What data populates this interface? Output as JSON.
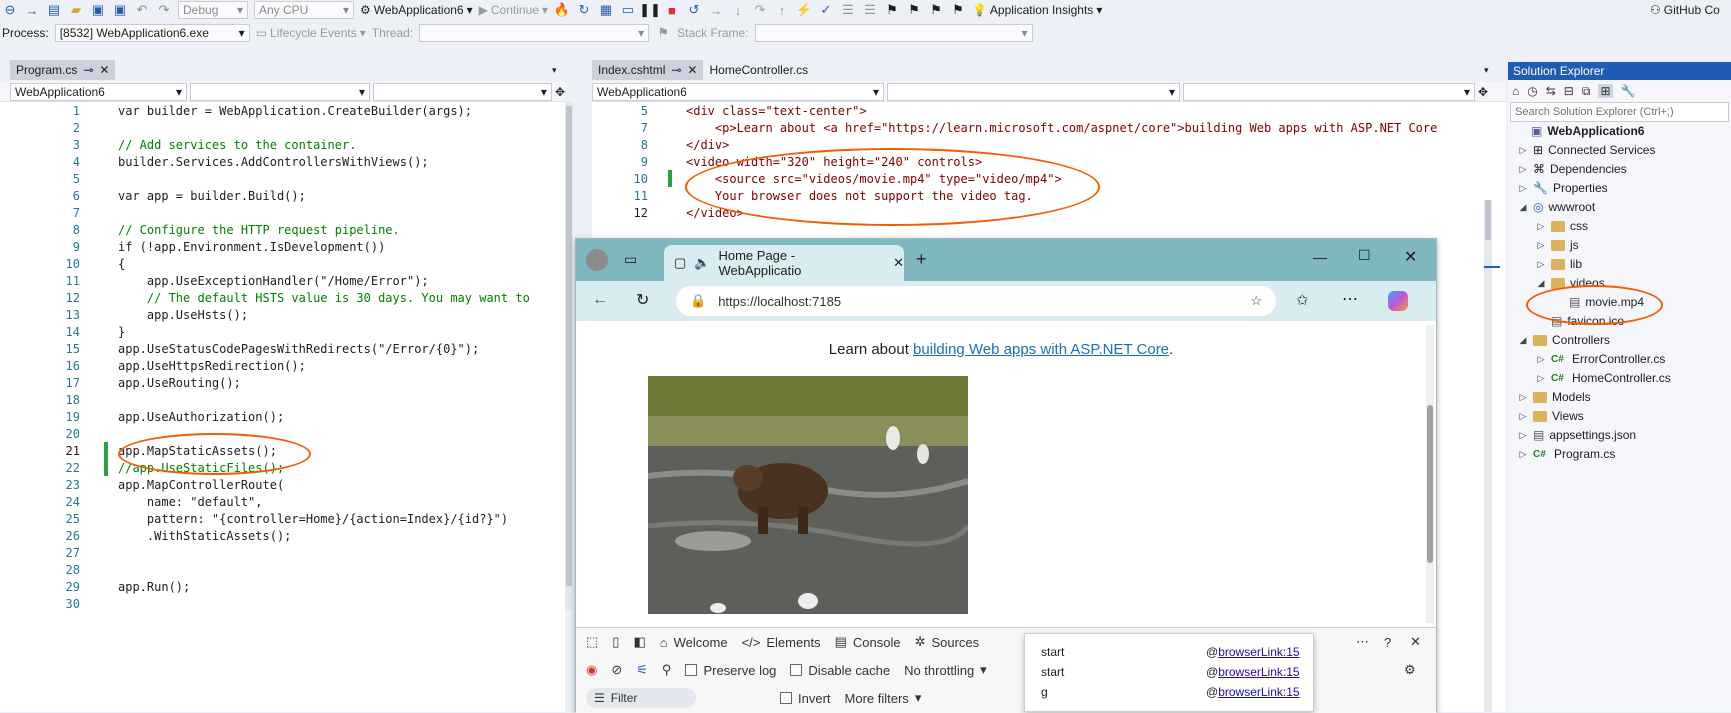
{
  "toolbar": {
    "config": "Debug",
    "platform": "Any CPU",
    "run_target": "WebApplication6",
    "continue_label": "Continue",
    "app_insights": "Application Insights",
    "github_copilot": "GitHub Co"
  },
  "debugbar": {
    "process_label": "Process:",
    "process_value": "[8532] WebApplication6.exe",
    "lifecycle_label": "Lifecycle Events",
    "thread_label": "Thread:",
    "stackframe_label": "Stack Frame:"
  },
  "left_editor": {
    "tab": "Program.cs",
    "nav_project": "WebApplication6",
    "lines": [
      {
        "n": "1",
        "code": "var builder = WebApplication.CreateBuilder(args);"
      },
      {
        "n": "2",
        "code": ""
      },
      {
        "n": "3",
        "code": "// Add services to the container."
      },
      {
        "n": "4",
        "code": "builder.Services.AddControllersWithViews();"
      },
      {
        "n": "5",
        "code": ""
      },
      {
        "n": "6",
        "code": "var app = builder.Build();"
      },
      {
        "n": "7",
        "code": ""
      },
      {
        "n": "8",
        "code": "// Configure the HTTP request pipeline."
      },
      {
        "n": "9",
        "code": "if (!app.Environment.IsDevelopment())"
      },
      {
        "n": "10",
        "code": "{"
      },
      {
        "n": "11",
        "code": "    app.UseExceptionHandler(\"/Home/Error\");"
      },
      {
        "n": "12",
        "code": "    // The default HSTS value is 30 days. You may want to"
      },
      {
        "n": "13",
        "code": "    app.UseHsts();"
      },
      {
        "n": "14",
        "code": "}"
      },
      {
        "n": "15",
        "code": "app.UseStatusCodePagesWithRedirects(\"/Error/{0}\");"
      },
      {
        "n": "16",
        "code": "app.UseHttpsRedirection();"
      },
      {
        "n": "17",
        "code": "app.UseRouting();"
      },
      {
        "n": "18",
        "code": ""
      },
      {
        "n": "19",
        "code": "app.UseAuthorization();"
      },
      {
        "n": "20",
        "code": ""
      },
      {
        "n": "21",
        "code": "app.MapStaticAssets();"
      },
      {
        "n": "22",
        "code": "//app.UseStaticFiles();"
      },
      {
        "n": "23",
        "code": "app.MapControllerRoute("
      },
      {
        "n": "24",
        "code": "    name: \"default\","
      },
      {
        "n": "25",
        "code": "    pattern: \"{controller=Home}/{action=Index}/{id?}\")"
      },
      {
        "n": "26",
        "code": "    .WithStaticAssets();"
      },
      {
        "n": "27",
        "code": ""
      },
      {
        "n": "28",
        "code": ""
      },
      {
        "n": "29",
        "code": "app.Run();"
      },
      {
        "n": "30",
        "code": ""
      }
    ]
  },
  "right_editor": {
    "tab1": "Index.cshtml",
    "tab2": "HomeController.cs",
    "nav_project": "WebApplication6",
    "lines": [
      {
        "n": "5",
        "code": "<div class=\"text-center\">"
      },
      {
        "n": "7",
        "code": "    <p>Learn about <a href=\"https://learn.microsoft.com/aspnet/core\">building Web apps with ASP.NET Core"
      },
      {
        "n": "8",
        "code": "</div>"
      },
      {
        "n": "9",
        "code": "<video width=\"320\" height=\"240\" controls>"
      },
      {
        "n": "10",
        "code": "    <source src=\"videos/movie.mp4\" type=\"video/mp4\">"
      },
      {
        "n": "11",
        "code": "    Your browser does not support the video tag."
      },
      {
        "n": "12",
        "code": "</video>"
      }
    ]
  },
  "solution_explorer": {
    "title": "Solution Explorer",
    "search_placeholder": "Search Solution Explorer (Ctrl+;)",
    "items": [
      {
        "label": "WebApplication6"
      },
      {
        "label": "Connected Services"
      },
      {
        "label": "Dependencies"
      },
      {
        "label": "Properties"
      },
      {
        "label": "wwwroot"
      },
      {
        "label": "css"
      },
      {
        "label": "js"
      },
      {
        "label": "lib"
      },
      {
        "label": "videos"
      },
      {
        "label": "movie.mp4"
      },
      {
        "label": "favicon.ico"
      },
      {
        "label": "Controllers"
      },
      {
        "label": "ErrorController.cs"
      },
      {
        "label": "HomeController.cs"
      },
      {
        "label": "Models"
      },
      {
        "label": "Views"
      },
      {
        "label": "appsettings.json"
      },
      {
        "label": "Program.cs"
      }
    ]
  },
  "browser": {
    "tab_title": "Home Page - WebApplicatio",
    "url": "https://localhost:7185",
    "page_text": "Learn about ",
    "page_link": "building Web apps with ASP.NET Core",
    "devtools": {
      "tabs": [
        "Welcome",
        "Elements",
        "Console",
        "Sources"
      ],
      "preserve_log": "Preserve log",
      "disable_cache": "Disable cache",
      "throttling": "No throttling",
      "filter": "Filter",
      "invert": "Invert",
      "more_filters": "More filters"
    }
  },
  "console_popup": {
    "rows": [
      {
        "msg": "start",
        "src": "browserLink:15"
      },
      {
        "msg": "start",
        "src": "browserLink:15"
      },
      {
        "msg": "g",
        "src": "browserLink:15"
      }
    ]
  }
}
